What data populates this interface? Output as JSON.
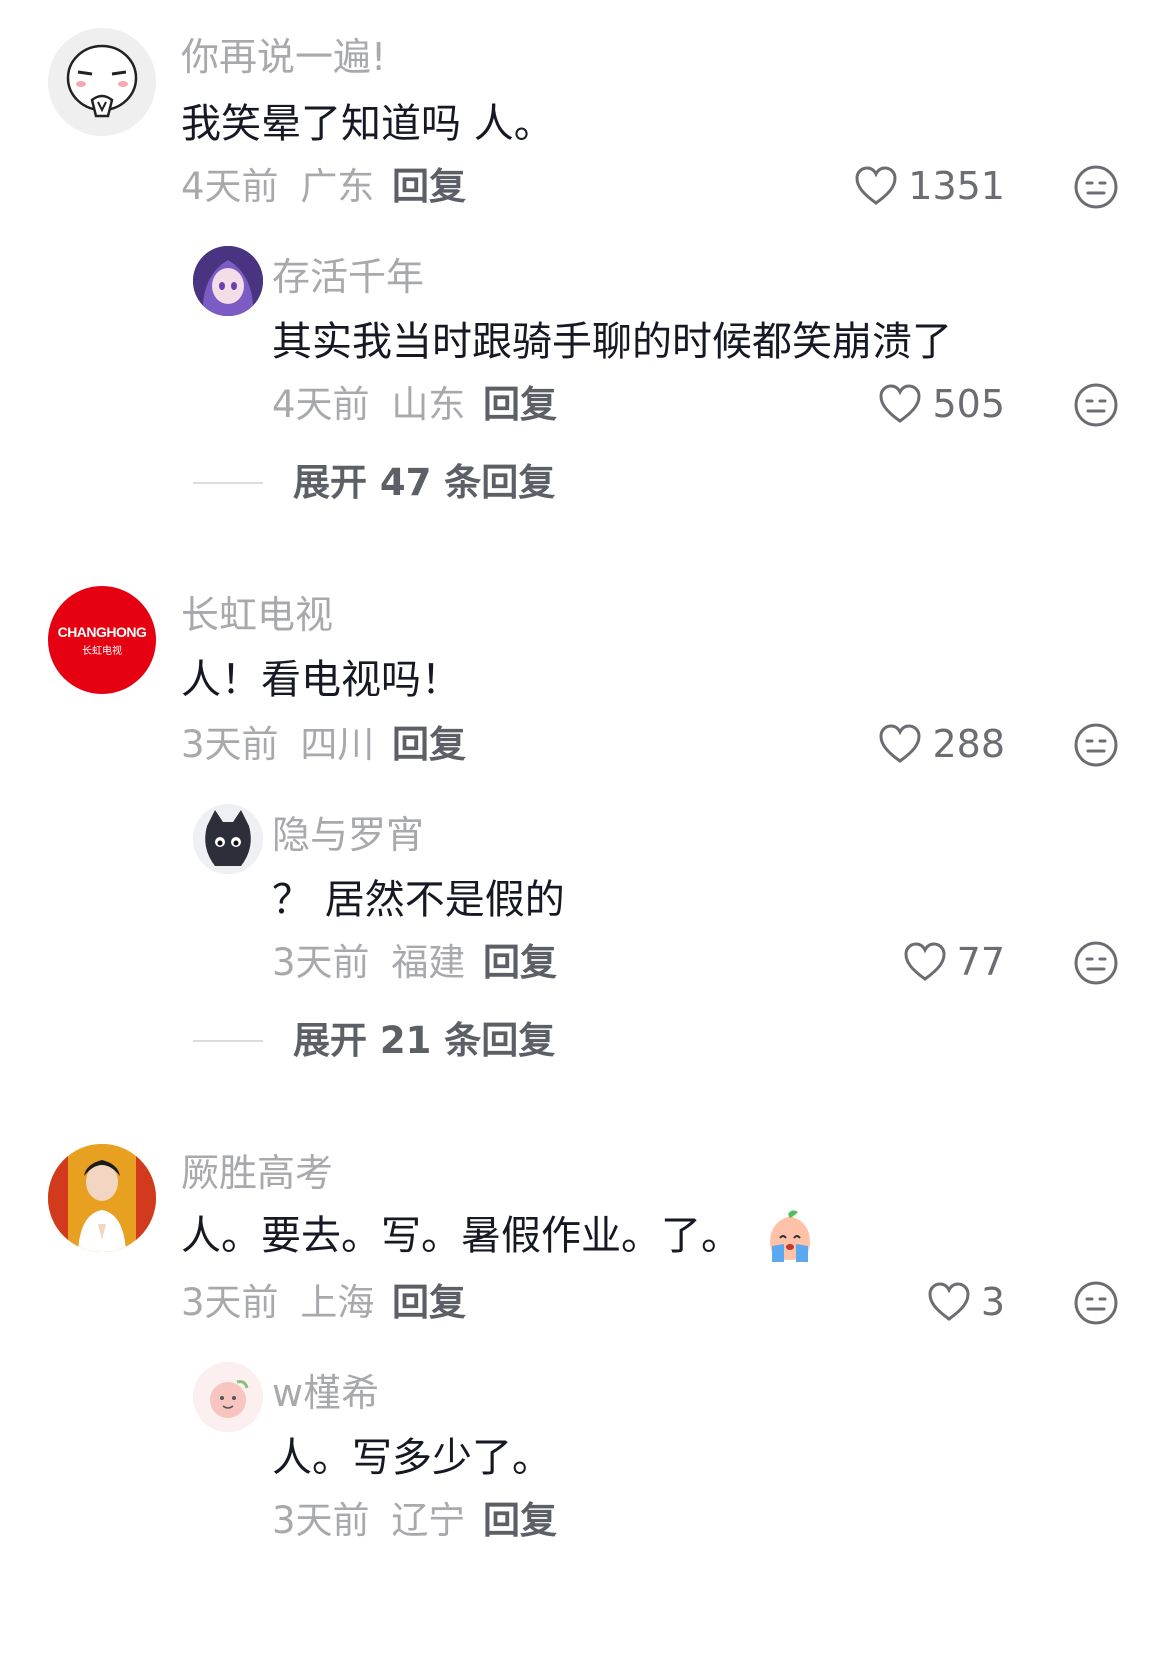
{
  "comments": [
    {
      "name": "你再说一遍!",
      "text": "我笑晕了知道吗 人。",
      "time": "4天前",
      "region": "广东",
      "reply_label": "回复",
      "likes": "1351",
      "avatar_icon": "cartoon-face-icon",
      "sub": {
        "name": "存活千年",
        "text": "其实我当时跟骑手聊的时候都笑崩溃了",
        "time": "4天前",
        "region": "山东",
        "reply_label": "回复",
        "likes": "505",
        "avatar_icon": "anime-girl-avatar"
      },
      "expand_label": "展开 47 条回复"
    },
    {
      "name": "长虹电视",
      "text": "人！看电视吗！",
      "time": "3天前",
      "region": "四川",
      "reply_label": "回复",
      "likes": "288",
      "avatar_logo": "CHANGHONG",
      "avatar_logo_sub": "长虹电视",
      "avatar_color": "#e50012",
      "sub": {
        "name": "隐与罗宵",
        "text": "？ 居然不是假的",
        "time": "3天前",
        "region": "福建",
        "reply_label": "回复",
        "likes": "77",
        "avatar_icon": "black-cat-avatar"
      },
      "expand_label": "展开 21 条回复"
    },
    {
      "name": "厥胜高考",
      "text": "人。要去。写。暑假作业。了。",
      "time": "3天前",
      "region": "上海",
      "reply_label": "回复",
      "likes": "3",
      "avatar_icon": "person-praying-avatar",
      "sub": {
        "name": "w槿希",
        "text": "人。写多少了。",
        "time": "3天前",
        "region": "辽宁",
        "reply_label": "回复",
        "avatar_icon": "peach-cartoon-avatar"
      }
    }
  ],
  "icons": {
    "like": "heart-outline-icon",
    "react": "neutral-face-icon",
    "inline_emoji": "crying-peach-emoji"
  },
  "colors": {
    "name": "#a8a9ad",
    "text": "#161823",
    "meta": "#a8a9ad",
    "action": "#5d5f66"
  }
}
